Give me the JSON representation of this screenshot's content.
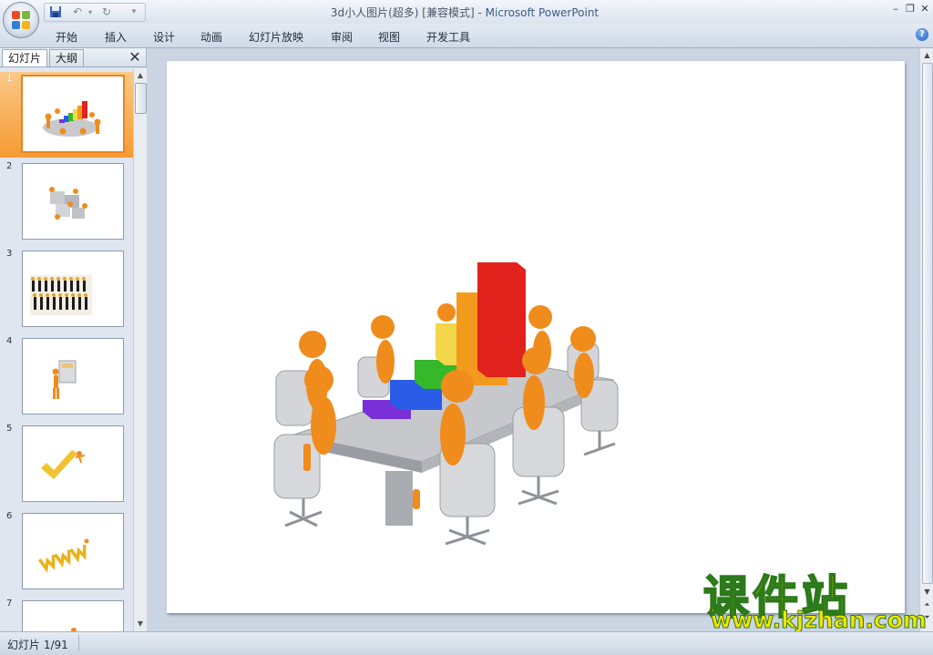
{
  "app": {
    "doc_name": "3d小人图片(超多) [兼容模式]",
    "separator": " - ",
    "app_name": "Microsoft PowerPoint"
  },
  "ribbon": {
    "tabs": [
      "开始",
      "插入",
      "设计",
      "动画",
      "幻灯片放映",
      "审阅",
      "视图",
      "开发工具"
    ]
  },
  "pane": {
    "tabs": [
      "幻灯片",
      "大纲"
    ],
    "slides": [
      {
        "num": "1",
        "selected": true,
        "icon": "meeting-chart-thumbnail"
      },
      {
        "num": "2",
        "selected": false,
        "icon": "puzzle-people-thumbnail"
      },
      {
        "num": "3",
        "selected": false,
        "icon": "crowd-people-thumbnail"
      },
      {
        "num": "4",
        "selected": false,
        "icon": "person-calculator-thumbnail"
      },
      {
        "num": "5",
        "selected": false,
        "icon": "checkmark-person-thumbnail"
      },
      {
        "num": "6",
        "selected": false,
        "icon": "www-text-thumbnail"
      },
      {
        "num": "7",
        "selected": false,
        "icon": "person-thumbnail"
      }
    ]
  },
  "status": {
    "slide_info": "幻灯片 1/91"
  },
  "watermark": {
    "title": "课件站",
    "url": "www.kjzhan.com"
  },
  "colors": {
    "selected_slide": "#f69a33",
    "figure_orange": "#f08c1c",
    "bar_colors": [
      "#7a30d8",
      "#2a5ce8",
      "#35b82a",
      "#f3d64a",
      "#f39a1c",
      "#e2221c"
    ]
  }
}
